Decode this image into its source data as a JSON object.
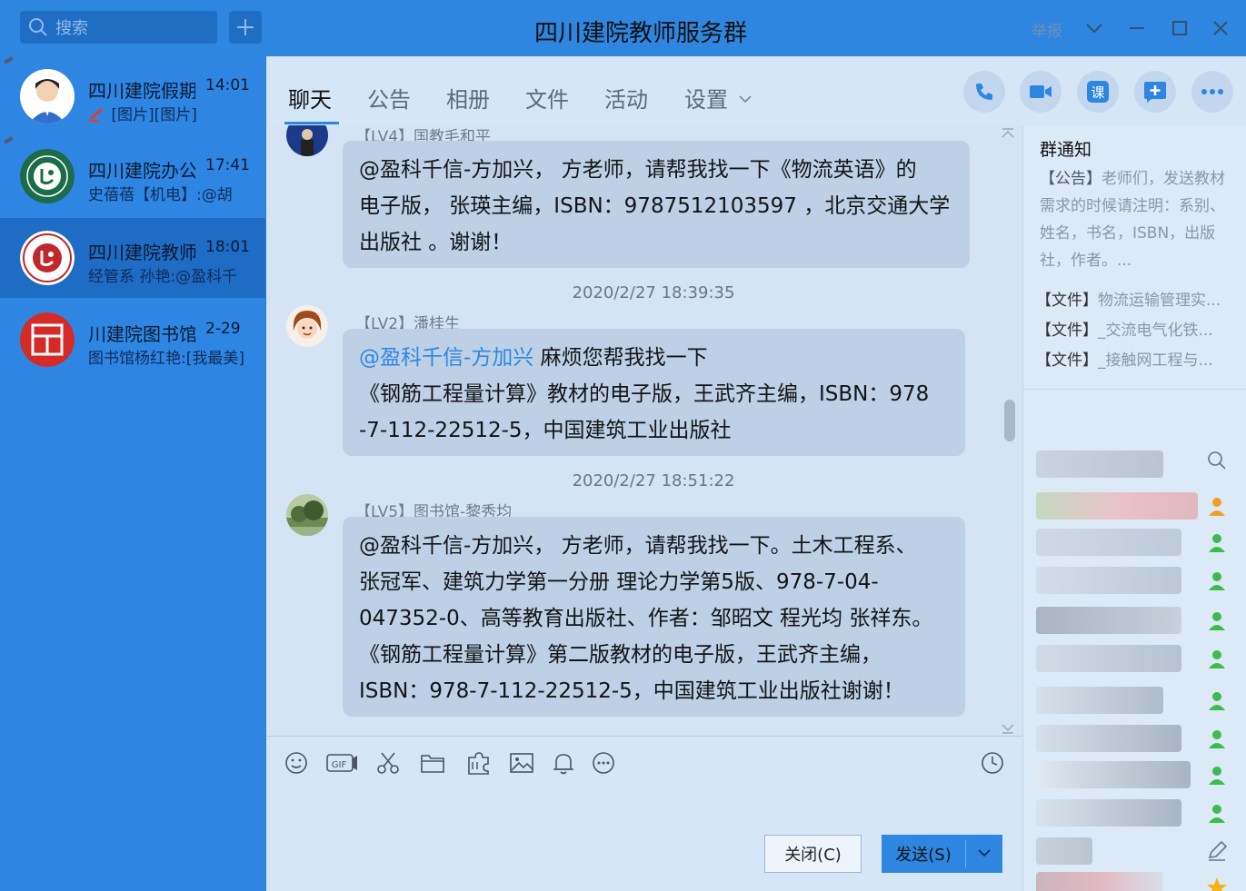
{
  "search": {
    "placeholder": "搜索"
  },
  "window": {
    "title": "四川建院教师服务群",
    "report": "举报"
  },
  "conversations": [
    {
      "name": "四川建院假期",
      "time": "14:01",
      "preview": "[图片][图片]"
    },
    {
      "name": "四川建院办公",
      "time": "17:41",
      "preview": "史蓓蓓【机电】:@胡"
    },
    {
      "name": "四川建院教师",
      "time": "18:01",
      "preview": "经管系 孙艳:@盈科千"
    },
    {
      "name": "川建院图书馆",
      "time": "2-29",
      "preview": "图书馆杨红艳:[我最美]"
    }
  ],
  "tabs": [
    "聊天",
    "公告",
    "相册",
    "文件",
    "活动",
    "设置"
  ],
  "messages": [
    {
      "sender": "【LV4】国教毛和平",
      "lines": [
        "@盈科千信-方加兴， 方老师，请帮我找一下《物流英语》的",
        "电子版， 张瑛主编，ISBN：9787512103597 ，北京交通大学",
        "出版社 。谢谢！"
      ]
    },
    {
      "timestamp": "2020/2/27 18:39:35",
      "sender": "【LV2】潘桂生",
      "mention": "@盈科千信-方加兴",
      "lines": [
        " 麻烦您帮我找一下",
        "《钢筋工程量计算》教材的电子版，王武齐主编，ISBN：978",
        "-7-112-22512-5，中国建筑工业出版社"
      ]
    },
    {
      "timestamp": "2020/2/27 18:51:22",
      "sender": "【LV5】图书馆-黎秀均",
      "lines": [
        "@盈科千信-方加兴， 方老师，请帮我找一下。土木工程系、",
        "张冠军、建筑力学第一分册 理论力学第5版、978-7-04-",
        "047352-0、高等教育出版社、作者：邹昭文 程光均 张祥东。",
        "《钢筋工程量计算》第二版教材的电子版，王武齐主编，",
        "ISBN：978-7-112-22512-5，中国建筑工业出版社谢谢！"
      ]
    }
  ],
  "buttons": {
    "close": "关闭(C)",
    "send": "发送(S)"
  },
  "notice": {
    "title": "群通知",
    "tag": "【公告】",
    "body": "老师们，发送教材需求的时候请注明：系别、姓名，书名，ISBN，出版社，作者。...",
    "files": [
      {
        "tag": "【文件】",
        "name": "物流运输管理实..."
      },
      {
        "tag": "【文件】",
        "name": "_交流电气化铁..."
      },
      {
        "tag": "【文件】",
        "name": "_接触网工程与..."
      }
    ]
  },
  "colors": {
    "titlebar": "#2e86e0",
    "sidebar": "#2f86e2",
    "bubble": "#bdd0e5",
    "mention": "#2f86e2"
  }
}
